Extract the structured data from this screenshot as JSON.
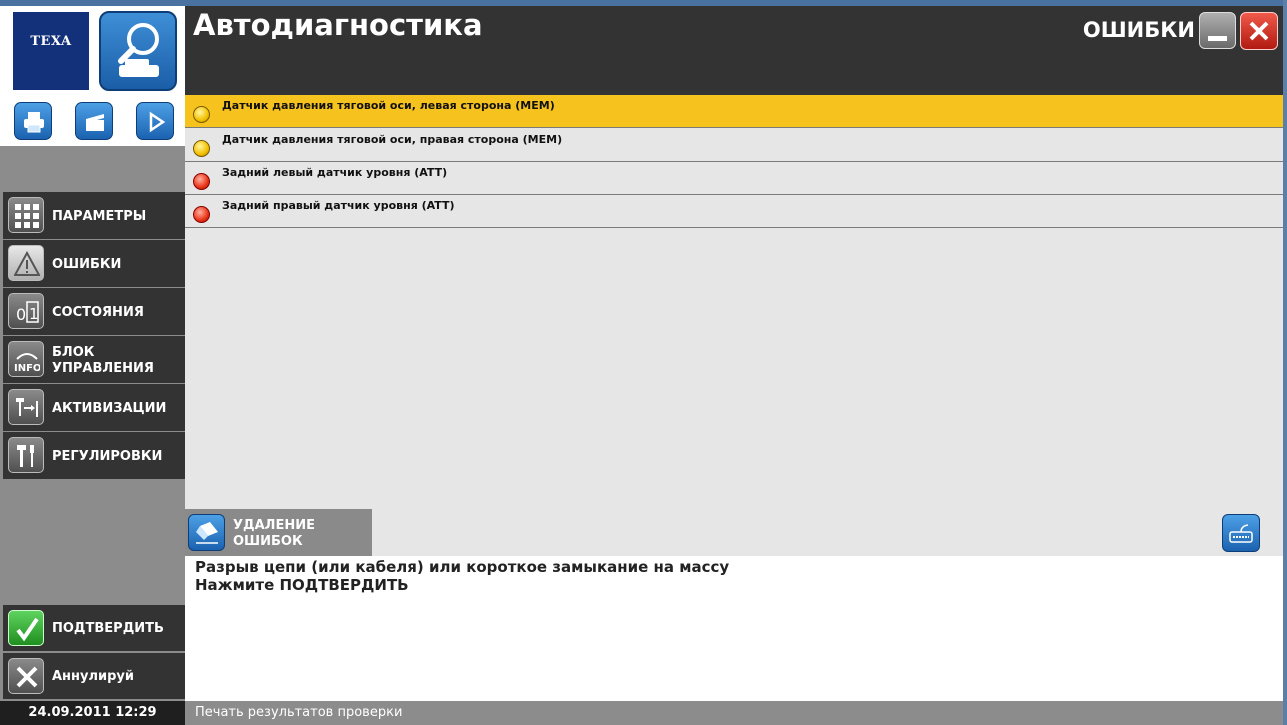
{
  "header": {
    "app_title": "Автодиагностика",
    "section_title": "ОШИБКИ"
  },
  "branding": {
    "logo_text": "TEXA"
  },
  "sidebar": {
    "items": [
      {
        "label": "ПАРАМЕТРЫ",
        "icon": "grid-icon"
      },
      {
        "label": "ОШИБКИ",
        "icon": "warning-icon"
      },
      {
        "label": "СОСТОЯНИЯ",
        "icon": "binary-state-icon"
      },
      {
        "label_line1": "БЛОК",
        "label_line2": "УПРАВЛЕНИЯ",
        "icon": "info-icon"
      },
      {
        "label": "АКТИВИЗАЦИИ",
        "icon": "activation-icon"
      },
      {
        "label": "РЕГУЛИРОВКИ",
        "icon": "tools-icon"
      }
    ],
    "confirm_label": "ПОДТВЕРДИТЬ",
    "cancel_label": "Аннулируй",
    "datetime": "24.09.2011  12:29"
  },
  "errors": {
    "rows": [
      {
        "text": "Датчик давления тяговой оси, левая сторона (MEM)",
        "status": "yellow",
        "selected": true
      },
      {
        "text": "Датчик давления тяговой оси, правая сторона (MEM)",
        "status": "yellow",
        "selected": false
      },
      {
        "text": "Задний левый датчик уровня  (ATT)",
        "status": "red",
        "selected": false
      },
      {
        "text": "Задний правый датчик уровня  (ATT)",
        "status": "red",
        "selected": false
      }
    ]
  },
  "actions": {
    "erase_line1": "УДАЛЕНИЕ",
    "erase_line2": "ОШИБОК"
  },
  "message": {
    "line1": "Разрыв цепи (или кабеля) или короткое замыкание на массу",
    "line2": "Нажмите ПОДТВЕРДИТЬ"
  },
  "status_bar": {
    "text": "Печать результатов проверки"
  },
  "colors": {
    "selected_row": "#f6c21e",
    "header_bg": "#333333",
    "accent_blue": "#1b62b0"
  }
}
